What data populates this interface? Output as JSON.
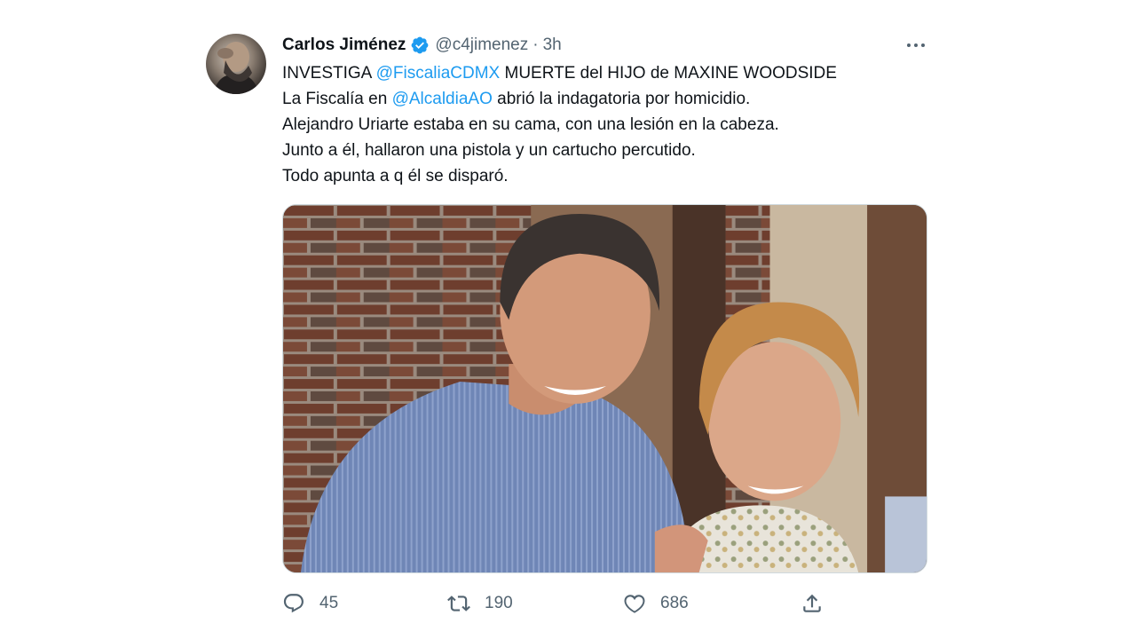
{
  "author": {
    "name": "Carlos Jiménez",
    "handle": "@c4jimenez",
    "separator": "·",
    "time": "3h",
    "verified": true
  },
  "tweet": {
    "line1": {
      "before": "INVESTIGA ",
      "mention": "@FiscaliaCDMX",
      "after": " MUERTE del HIJO de MAXINE WOODSIDE"
    },
    "line2": {
      "before": "La Fiscalía en ",
      "mention": "@AlcaldiaAO",
      "after": " abrió la indagatoria por homicidio."
    },
    "line3": "Alejandro Uriarte estaba en su cama, con una lesión en la cabeza.",
    "line4": "Junto a él, hallaron una pistola y un cartucho percutido.",
    "line5": "Todo apunta a q él se disparó."
  },
  "actions": {
    "reply_count": "45",
    "retweet_count": "190",
    "like_count": "686"
  },
  "icons": {
    "more": "more-options-icon",
    "verified": "verified-badge-icon",
    "reply": "reply-icon",
    "retweet": "retweet-icon",
    "like": "heart-icon",
    "share": "share-icon"
  },
  "colors": {
    "link": "#1d9bf0",
    "secondary_text": "#536471",
    "primary_text": "#0f1419"
  }
}
